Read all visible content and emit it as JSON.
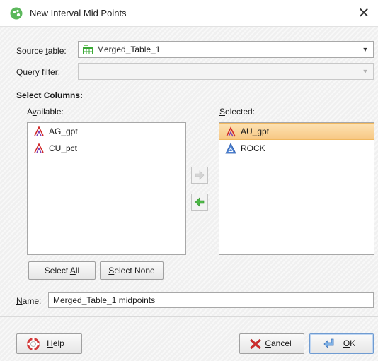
{
  "window": {
    "title": "New Interval Mid Points",
    "close_glyph": "✕"
  },
  "source_table": {
    "label": "Source table:",
    "value": "Merged_Table_1",
    "icon": "table-icon"
  },
  "query_filter": {
    "label": "Query filter:",
    "value": ""
  },
  "select_columns": {
    "heading": "Select Columns:",
    "available_label": "Available:",
    "selected_label": "Selected:",
    "available": [
      {
        "label": "AG_gpt",
        "icon": "numeric-column-icon"
      },
      {
        "label": "CU_pct",
        "icon": "numeric-column-icon"
      }
    ],
    "selected": [
      {
        "label": "AU_gpt",
        "icon": "numeric-column-icon",
        "highlighted": true
      },
      {
        "label": "ROCK",
        "icon": "category-column-icon",
        "highlighted": false
      }
    ],
    "select_all_label": "Select All",
    "select_none_label": "Select None"
  },
  "name": {
    "label": "Name:",
    "value": "Merged_Table_1 midpoints"
  },
  "buttons": {
    "help": "Help",
    "cancel": "Cancel",
    "ok": "OK"
  },
  "colors": {
    "accent_selected": "#fad9a3",
    "arrow_green": "#3aa935",
    "title_icon_green": "#5cb85c"
  }
}
